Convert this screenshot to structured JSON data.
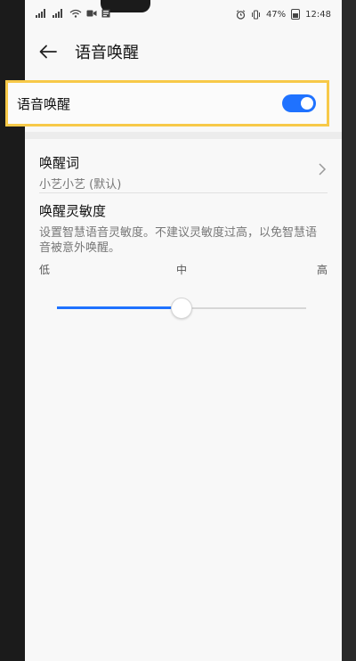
{
  "status_bar": {
    "left_icons": [
      "signal-icon",
      "signal-icon",
      "wifi-icon",
      "video-icon",
      "notification-icon"
    ],
    "alarm_icon": "alarm-icon",
    "vibrate_icon": "vibrate-icon",
    "battery_percent": "47%",
    "time": "12:48"
  },
  "header": {
    "title": "语音唤醒",
    "back_icon": "back-arrow-icon"
  },
  "voice_wake": {
    "label": "语音唤醒",
    "enabled": true,
    "accent": "#1f72ff",
    "highlight": "#f7c948"
  },
  "wake_word": {
    "title": "唤醒词",
    "value": "小艺小艺 (默认)"
  },
  "sensitivity": {
    "title": "唤醒灵敏度",
    "description": "设置智慧语音灵敏度。不建议灵敏度过高，以免智慧语音被意外唤醒。",
    "low_label": "低",
    "mid_label": "中",
    "high_label": "高",
    "level": 0.5
  }
}
